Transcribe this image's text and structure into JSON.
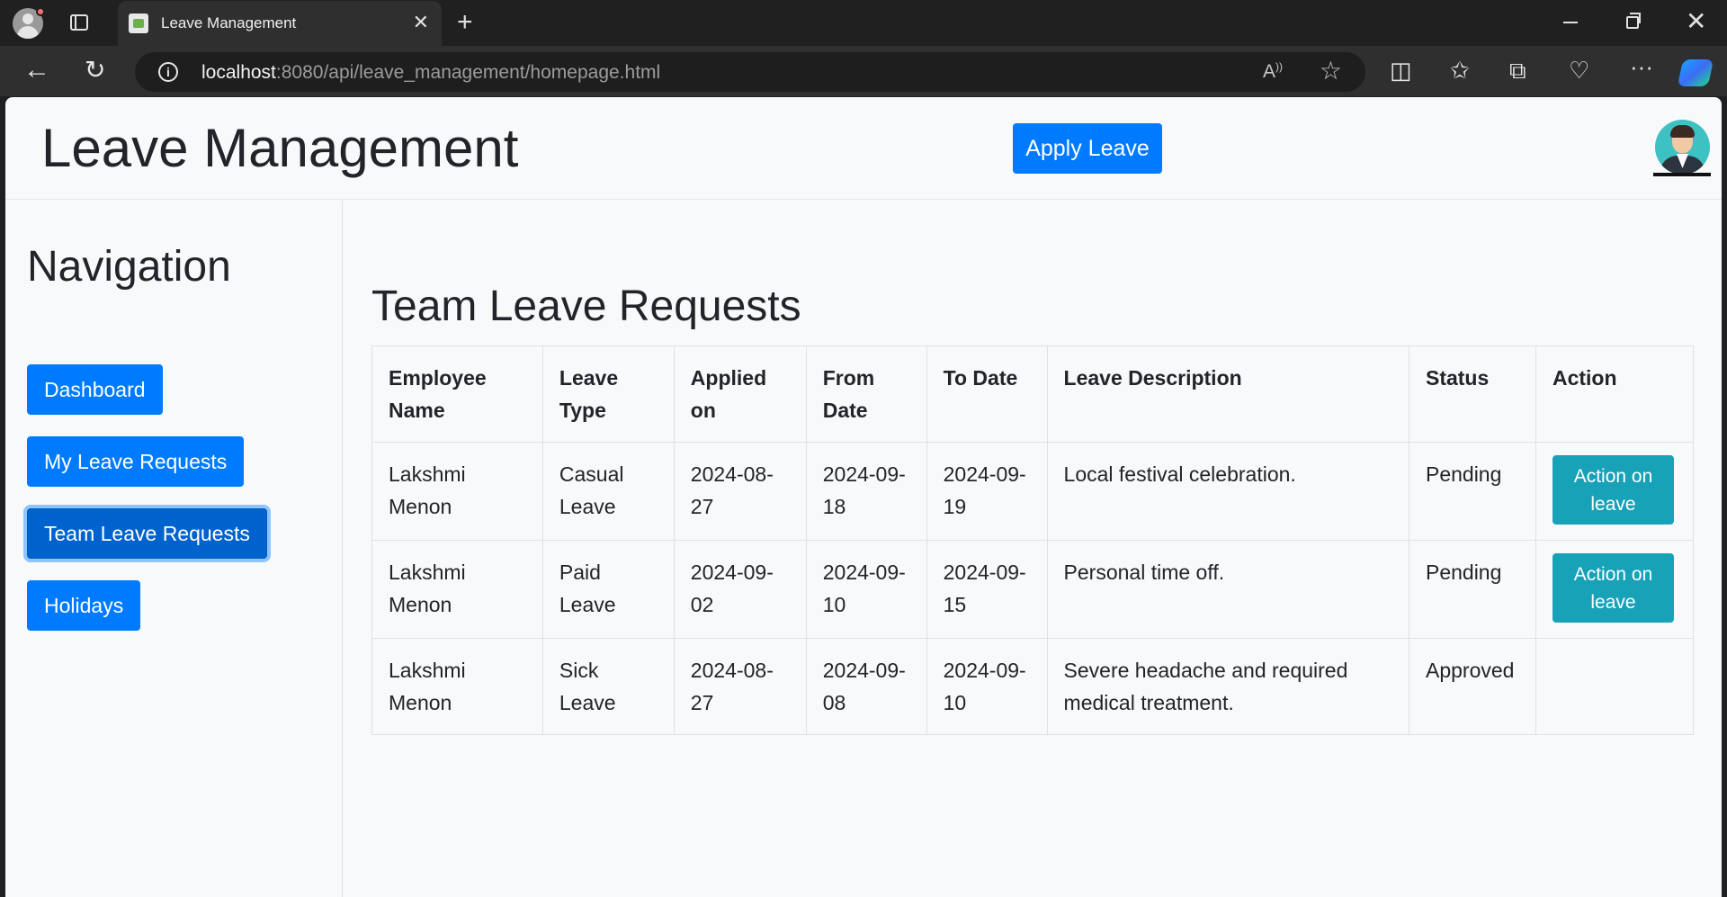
{
  "browser": {
    "tab_title": "Leave Management",
    "url_host": "localhost",
    "url_rest": ":8080/api/leave_management/homepage.html"
  },
  "header": {
    "title": "Leave Management",
    "apply_button": "Apply Leave"
  },
  "sidebar": {
    "title": "Navigation",
    "items": [
      {
        "label": "Dashboard",
        "active": false
      },
      {
        "label": "My Leave Requests",
        "active": false
      },
      {
        "label": "Team Leave Requests",
        "active": true
      },
      {
        "label": "Holidays",
        "active": false
      }
    ]
  },
  "main": {
    "title": "Team Leave Requests",
    "columns": [
      "Employee Name",
      "Leave Type",
      "Applied on",
      "From Date",
      "To Date",
      "Leave Description",
      "Status",
      "Action"
    ],
    "rows": [
      {
        "employee": "Lakshmi Menon",
        "type": "Casual Leave",
        "applied": "2024-08-27",
        "from": "2024-09-18",
        "to": "2024-09-19",
        "description": "Local festival celebration.",
        "status": "Pending",
        "action": "Action on leave"
      },
      {
        "employee": "Lakshmi Menon",
        "type": "Paid Leave",
        "applied": "2024-09-02",
        "from": "2024-09-10",
        "to": "2024-09-15",
        "description": "Personal time off.",
        "status": "Pending",
        "action": "Action on leave"
      },
      {
        "employee": "Lakshmi Menon",
        "type": "Sick Leave",
        "applied": "2024-08-27",
        "from": "2024-09-08",
        "to": "2024-09-10",
        "description": "Severe headache and required medical treatment.",
        "status": "Approved",
        "action": ""
      }
    ]
  },
  "colors": {
    "primary": "#007bff",
    "info": "#17a2b8",
    "background": "#f8f9fa"
  }
}
